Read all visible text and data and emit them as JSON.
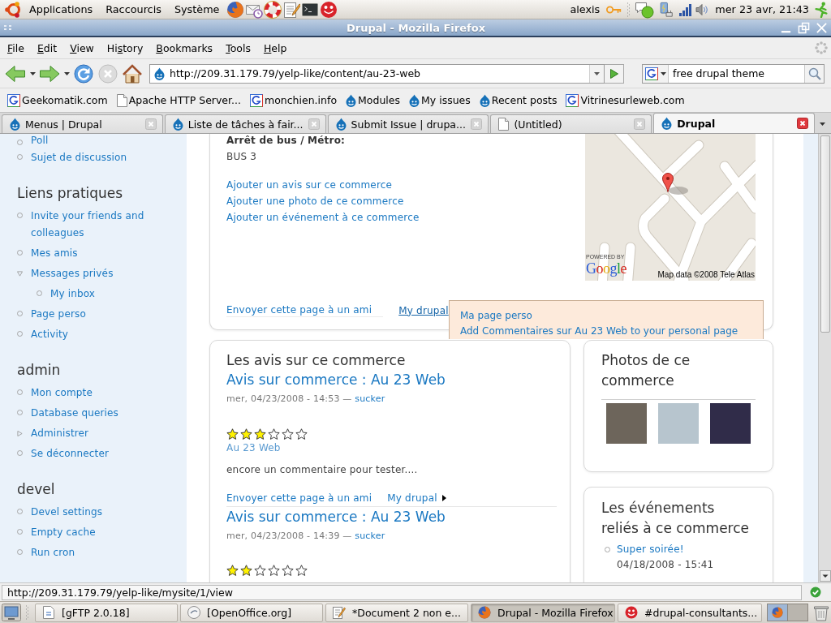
{
  "top_panel": {
    "menus": [
      "Applications",
      "Raccourcis",
      "Système"
    ],
    "user": "alexis",
    "clock": "mer 23 avr, 21:43"
  },
  "window": {
    "title": "Drupal - Mozilla Firefox"
  },
  "menu_bar": [
    {
      "key": "F",
      "post": "ile"
    },
    {
      "key": "E",
      "post": "dit"
    },
    {
      "key": "V",
      "post": "iew"
    },
    {
      "pre": "Hi",
      "key": "s",
      "post": "tory"
    },
    {
      "key": "B",
      "post": "ookmarks"
    },
    {
      "key": "T",
      "post": "ools"
    },
    {
      "key": "H",
      "post": "elp"
    }
  ],
  "navigation": {
    "url": "http://209.31.179.79/yelp-like/content/au-23-web",
    "search": "free drupal theme"
  },
  "bookmarks": [
    {
      "label": "Geekomatik.com",
      "kind": "google"
    },
    {
      "label": "Apache HTTP Server...",
      "kind": "page"
    },
    {
      "label": "monchien.info",
      "kind": "google"
    },
    {
      "label": "Modules",
      "kind": "drupal"
    },
    {
      "label": "My issues",
      "kind": "drupal"
    },
    {
      "label": "Recent posts",
      "kind": "drupal"
    },
    {
      "label": "Vitrinesurleweb.com",
      "kind": "google"
    }
  ],
  "tabs": [
    {
      "label": "Menus | Drupal",
      "kind": "drupal",
      "selected": false
    },
    {
      "label": "Liste de tâches à fair...",
      "kind": "drupal",
      "selected": false
    },
    {
      "label": "Submit Issue | drupa...",
      "kind": "drupal",
      "selected": false
    },
    {
      "label": "(Untitled)",
      "kind": "page",
      "selected": false
    },
    {
      "label": "Drupal",
      "kind": "drupal",
      "selected": true
    }
  ],
  "sidebar": [
    {
      "items": [
        {
          "label": "Poll",
          "kind": "leaf"
        },
        {
          "label": "Sujet de discussion",
          "kind": "leaf"
        }
      ]
    },
    {
      "title": "Liens pratiques",
      "items": [
        {
          "label": "Invite your friends and colleagues",
          "kind": "leaf"
        },
        {
          "label": "Mes amis",
          "kind": "leaf"
        },
        {
          "label": "Messages privés",
          "kind": "expanded",
          "children": [
            {
              "label": "My inbox",
              "kind": "leaf"
            }
          ]
        },
        {
          "label": "Page perso",
          "kind": "leaf"
        },
        {
          "label": "Activity",
          "kind": "leaf"
        }
      ]
    },
    {
      "title": "admin",
      "items": [
        {
          "label": "Mon compte",
          "kind": "leaf"
        },
        {
          "label": "Database queries",
          "kind": "leaf"
        },
        {
          "label": "Administrer",
          "kind": "collapsed"
        },
        {
          "label": "Se déconnecter",
          "kind": "leaf"
        }
      ]
    },
    {
      "title": "devel",
      "items": [
        {
          "label": "Devel settings",
          "kind": "leaf"
        },
        {
          "label": "Empty cache",
          "kind": "leaf"
        },
        {
          "label": "Run cron",
          "kind": "leaf"
        }
      ]
    }
  ],
  "location": {
    "label": "Arrêt de bus / Métro:",
    "value": "BUS 3",
    "links": [
      "Ajouter un avis sur ce commerce",
      "Ajouter une photo de ce commerce",
      "Ajouter un événement à ce commerce"
    ],
    "map": {
      "credit": "POWERED BY",
      "logo": "Google",
      "attribution": "Map data ©2008 Tele Atlas"
    },
    "footer_links": [
      {
        "label": "Envoyer cette page à un ami",
        "kind": "link"
      },
      {
        "label": "My drupal",
        "kind": "menu",
        "open": true,
        "menu": [
          "Ma page perso",
          "Add Commentaires sur Au 23 Web to your personal page"
        ]
      }
    ]
  },
  "reviews": {
    "title": "Les avis sur ce commerce",
    "items": [
      {
        "title": "Avis sur commerce : Au 23 Web",
        "date": "mer, 04/23/2008 - 14:53 —",
        "author": "sucker",
        "stars": 3,
        "subject": "Au 23 Web",
        "body": "encore un commentaire pour tester....",
        "links": [
          {
            "label": "Envoyer cette page à un ami",
            "kind": "link"
          },
          {
            "label": "My drupal",
            "kind": "menu",
            "open": false
          }
        ]
      },
      {
        "title": "Avis sur commerce : Au 23 Web",
        "date": "mer, 04/23/2008 - 14:39 —",
        "author": "sucker",
        "stars": 2
      }
    ]
  },
  "photos": {
    "title": "Photos de ce commerce"
  },
  "events": {
    "title": "Les événements reliés à ce commerce",
    "items": [
      {
        "title": "Super soirée!",
        "date": "04/18/2008 - 15:41"
      }
    ]
  },
  "status_bar": {
    "text": "http://209.31.179.79/yelp-like/mysite/1/view"
  },
  "taskbar": [
    {
      "label": "[gFTP 2.0.18]",
      "kind": "ftp",
      "selected": false
    },
    {
      "label": "[OpenOffice.org]",
      "kind": "office",
      "selected": false
    },
    {
      "label": "*Document 2 non e...",
      "kind": "editor",
      "selected": false
    },
    {
      "label": "Drupal - Mozilla Firefox",
      "kind": "browser",
      "selected": true
    },
    {
      "label": "#drupal-consultants...",
      "kind": "chat",
      "selected": false
    }
  ]
}
